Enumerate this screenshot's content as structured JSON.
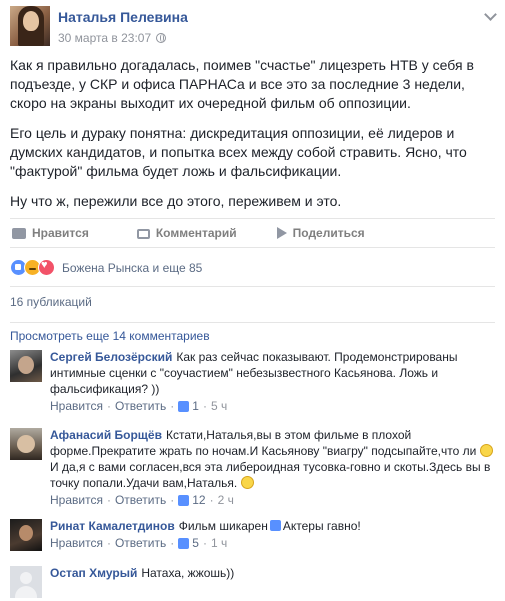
{
  "post": {
    "author": "Наталья Пелевина",
    "timestamp": "30 марта в 23:07",
    "paragraphs": [
      "Как я правильно догадалась, поимев \"счастье\" лицезреть НТВ у себя в подъезде, у СКР и офиса ПАРНАСа и все это за последние 3 недели, скоро на экраны выходит их очередной фильм об оппозиции.",
      "Его цель и дураку понятна: дискредитация оппозиции, её лидеров и думских кандидатов, и попытка всех между собой стравить. Ясно, что \"фактурой\" фильма будет ложь и фальсификации.",
      "Ну что ж, пережили все до этого, переживем и это."
    ]
  },
  "actions": {
    "like": "Нравится",
    "comment": "Комментарий",
    "share": "Поделиться"
  },
  "reactions": {
    "summary": "Божена Рынска и еще 85"
  },
  "shares": "16 публикаций",
  "more_comments": "Просмотреть еще 14 комментариев",
  "comment_footer": {
    "like": "Нравится",
    "reply": "Ответить"
  },
  "comments": [
    {
      "author": "Сергей Белозёрский",
      "text": "Как раз сейчас показывают. Продемонстрированы интимные сценки с \"соучастием\" небезызвестного Касьянова. Ложь и фальсификация? ))",
      "likes": "1",
      "time": "5 ч"
    },
    {
      "author": "Афанасий Борщёв",
      "text_1": "Кстати,Наталья,вы в этом фильме в плохой форме.Прекратите жрать по ночам.И Касьянову \"виагру\" подсыпайте,что ли",
      "text_2": "И да,я с вами согласен,вся эта либероидная тусовка-говно и скоты.Здесь вы в точку попали.Удачи вам,Наталья.",
      "likes": "12",
      "time": "2 ч"
    },
    {
      "author": "Ринат Камалетдинов",
      "text_1": "Фильм шикарен",
      "text_2": "Актеры гавно!",
      "likes": "5",
      "time": "1 ч"
    },
    {
      "author": "Остап Хмурый",
      "text": "Натаха, жжошь))"
    }
  ]
}
